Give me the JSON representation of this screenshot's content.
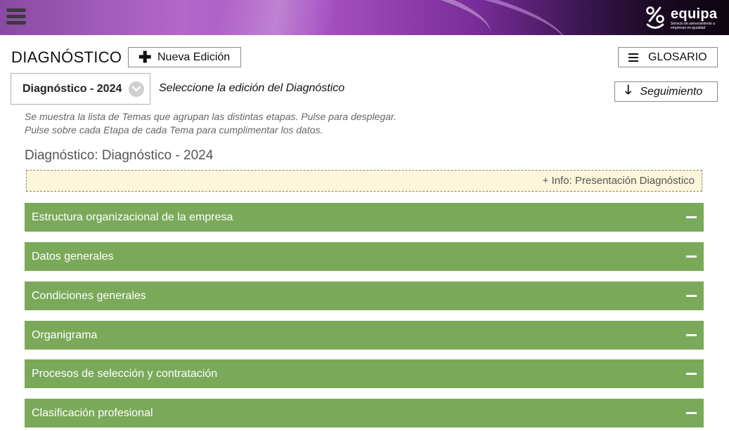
{
  "header": {
    "logo_text": "equipa",
    "logo_tagline": "Servicio de asesoramiento a empresas en igualdad"
  },
  "page": {
    "title": "DIAGNÓSTICO",
    "new_edition_label": "Nueva Edición",
    "glossary_label": "GLOSARIO",
    "tracking_label": "Seguimiento"
  },
  "edition": {
    "selected": "Diagnóstico - 2024",
    "hint": "Seleccione la edición del Diagnóstico"
  },
  "help": {
    "line1": "Se muestra la lista de Temas que agrupan las distintas etapas. Pulse para desplegar.",
    "line2": "Pulse sobre cada Etapa de cada Tema para cumplimentar los datos."
  },
  "section": {
    "title": "Diagnóstico: Diagnóstico - 2024",
    "info_link": "+ Info: Presentación Diagnóstico"
  },
  "topics": [
    {
      "label": "Estructura organizacional de la empresa"
    },
    {
      "label": "Datos generales"
    },
    {
      "label": "Condiciones generales"
    },
    {
      "label": "Organigrama"
    },
    {
      "label": "Procesos de selección y contratación"
    },
    {
      "label": "Clasificación profesional"
    }
  ],
  "colors": {
    "accordion_green": "#7aa95a",
    "info_bg": "#fdf6da",
    "banner_purple": "#a44fc0"
  }
}
